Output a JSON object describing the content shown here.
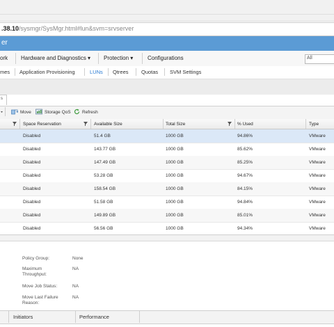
{
  "browser": {
    "url_prefix": ".38.10",
    "url_path": "/sysmgr/SysMgr.html#lun&svm=srvserver"
  },
  "header": {
    "title": "er"
  },
  "menu": {
    "items": [
      "ork",
      "Hardware and Diagnostics ▾",
      "Protection ▾",
      "Configurations"
    ],
    "search_value": "All"
  },
  "submenu": {
    "items": [
      "mes",
      "Application Provisioning",
      "LUNs",
      "Qtrees",
      "Quotas",
      "SVM Settings"
    ],
    "active": "LUNs"
  },
  "tab": {
    "label": "s"
  },
  "toolbar": {
    "move_label": "Move",
    "qos_label": "Storage QoS",
    "refresh_label": "Refresh"
  },
  "grid": {
    "columns": [
      "Space Reservation",
      "Available Size",
      "Total Size",
      "% Used",
      "Type"
    ],
    "rows": [
      [
        "Disabled",
        "51.4 GB",
        "1000 GB",
        "94.86%",
        "VMware"
      ],
      [
        "Disabled",
        "143.77 GB",
        "1000 GB",
        "85.62%",
        "VMware"
      ],
      [
        "Disabled",
        "147.49 GB",
        "1000 GB",
        "85.25%",
        "VMware"
      ],
      [
        "Disabled",
        "53.28 GB",
        "1000 GB",
        "94.67%",
        "VMware"
      ],
      [
        "Disabled",
        "158.54 GB",
        "1000 GB",
        "84.15%",
        "VMware"
      ],
      [
        "Disabled",
        "51.58 GB",
        "1000 GB",
        "94.84%",
        "VMware"
      ],
      [
        "Disabled",
        "149.89 GB",
        "1000 GB",
        "85.01%",
        "VMware"
      ],
      [
        "Disabled",
        "56.56 GB",
        "1000 GB",
        "94.34%",
        "VMware"
      ]
    ]
  },
  "details": {
    "policy_group_label": "Policy Group:",
    "policy_group_value": "None",
    "max_throughput_label_1": "Maximum",
    "max_throughput_label_2": "Throughput:",
    "max_throughput_value": "NA",
    "move_job_status_label": "Move Job Status:",
    "move_job_status_value": "NA",
    "move_last_failure_label_1": "Move Last Failure",
    "move_last_failure_label_2": "Reason:",
    "move_last_failure_value": "NA"
  },
  "bottom_tabs": [
    "Initiators",
    "Performance"
  ],
  "colors": {
    "header_blue": "#5b9bd5",
    "selected_row": "#dbe8f7",
    "active_link": "#2a7bd3"
  }
}
